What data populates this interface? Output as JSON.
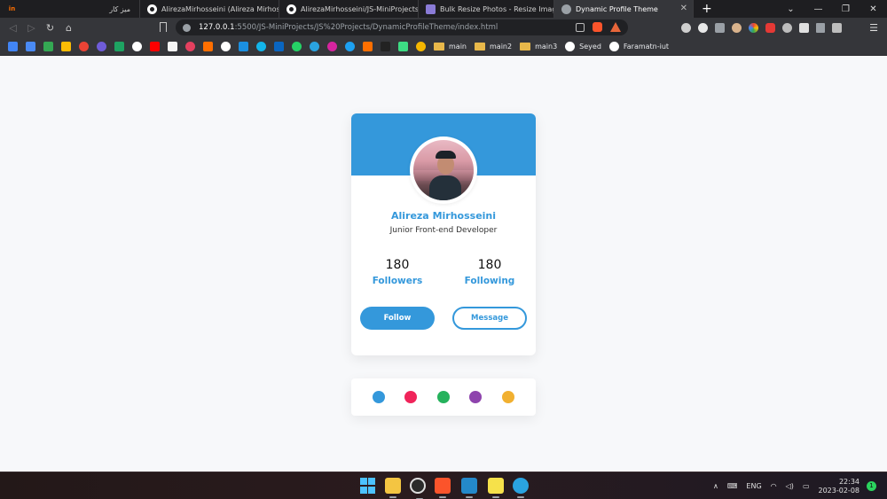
{
  "browser": {
    "tabs": [
      {
        "title": "میز کار",
        "icon": "invision-icon"
      },
      {
        "title": "AlirezaMirhosseini (Alireza Mirhosseini)",
        "icon": "github-icon"
      },
      {
        "title": "AlirezaMirhosseini/JS-MiniProjects: so",
        "icon": "github-icon"
      },
      {
        "title": "Bulk Resize Photos - Resize Images",
        "icon": "bulk-resize-icon"
      },
      {
        "title": "Dynamic Profile Theme",
        "icon": "globe-icon",
        "active": true
      }
    ],
    "new_tab": "+",
    "url_host": "127.0.0.1",
    "url_path": ":5500/JS-MiniProjects/JS%20Projects/DynamicProfileTheme/index.html",
    "bookmark_folders": [
      "main",
      "main2",
      "main3"
    ],
    "bookmark_links": [
      "Seyed",
      "Faramatn-iut"
    ]
  },
  "profile": {
    "name": "Alireza Mirhosseini",
    "role": "Junior Front-end Developer",
    "followers": {
      "count": "180",
      "label": "Followers"
    },
    "following": {
      "count": "180",
      "label": "Following"
    },
    "follow_label": "Follow",
    "message_label": "Message"
  },
  "theme": {
    "accent": "#3498db",
    "swatches": [
      {
        "name": "blue",
        "color": "#3498db"
      },
      {
        "name": "red",
        "color": "#f0245a"
      },
      {
        "name": "green",
        "color": "#25b25c"
      },
      {
        "name": "purple",
        "color": "#8e44ad"
      },
      {
        "name": "orange",
        "color": "#f1b030"
      }
    ]
  },
  "taskbar": {
    "language": "ENG",
    "time": "22:34",
    "date": "2023-02-08",
    "notification_count": "1"
  }
}
